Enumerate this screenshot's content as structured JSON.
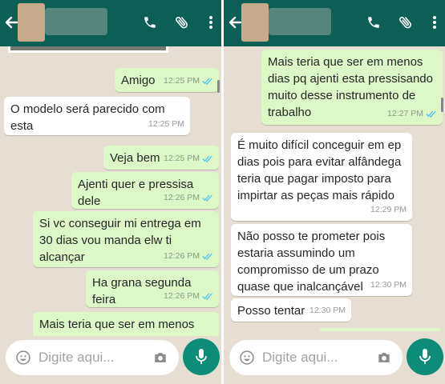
{
  "left": {
    "messages": [
      {
        "text": "Amigo",
        "time": "12:25 PM",
        "dir": "out"
      },
      {
        "text": "O modelo será parecido com esta",
        "time": "12:25 PM",
        "dir": "in"
      },
      {
        "text": "Veja bem",
        "time": "12:25 PM",
        "dir": "out"
      },
      {
        "text": "Ajenti quer e pressisa dele",
        "time": "12:26 PM",
        "dir": "out"
      },
      {
        "text": "Si vc conseguir mi entrega em 30 dias vou manda elw ti alcançar",
        "time": "12:26 PM",
        "dir": "out"
      },
      {
        "text": "Ha grana segunda feira",
        "time": "12:26 PM",
        "dir": "out"
      },
      {
        "text": "Mais teria que ser em menos dias",
        "time": "",
        "dir": "out"
      }
    ],
    "input_placeholder": "Digite aqui..."
  },
  "right": {
    "messages": [
      {
        "text": "Mais teria que ser em menos dias pq ajenti esta pressisando muito desse instrumento de trabalho",
        "time": "12:27 PM",
        "dir": "out"
      },
      {
        "text": "É muito difícil conceguir em ep dias pois para evitar alfândega teria que pagar imposto para impirtar as peças mais rápido",
        "time": "12:29 PM",
        "dir": "in"
      },
      {
        "text": "Não posso te prometer pois estaria assumindo um compromisso de um prazo quase que inalcançável",
        "time": "12:30 PM",
        "dir": "in"
      },
      {
        "text": "Posso tentar",
        "time": "12:30 PM",
        "dir": "in"
      }
    ],
    "input_placeholder": "Digite aqui..."
  },
  "icons": {
    "back": "arrow-left-icon",
    "call": "phone-icon",
    "attach": "paperclip-icon",
    "menu": "more-vert-icon",
    "emoji": "emoji-icon",
    "camera": "camera-icon",
    "mic": "mic-icon",
    "read": "double-check-icon"
  },
  "colors": {
    "header": "#0d5f55",
    "outgoing": "#dcf8c6",
    "incoming": "#ffffff",
    "background": "#e6ddd3",
    "mic_button": "#0d8c77",
    "read_ticks": "#4fc3f7"
  }
}
